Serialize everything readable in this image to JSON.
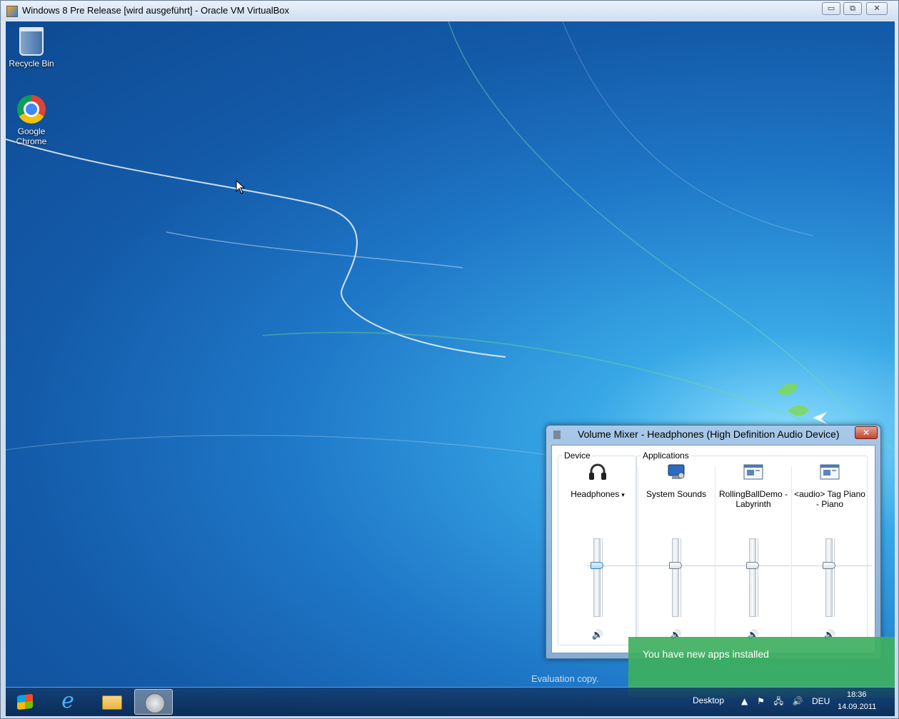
{
  "host": {
    "title": "Windows 8 Pre Release [wird ausgeführt] - Oracle VM VirtualBox",
    "buttons": {
      "minimize": "▭",
      "restore": "⧉",
      "close": "✕"
    }
  },
  "desktop": {
    "icons": [
      {
        "label": "Recycle Bin",
        "icon": "recycle-bin-icon"
      },
      {
        "label": "Google Chrome",
        "icon": "chrome-icon"
      }
    ]
  },
  "mixer": {
    "title": "Volume Mixer - Headphones (High Definition Audio Device)",
    "close": "✕",
    "device_group": "Device",
    "applications_group": "Applications",
    "channels": [
      {
        "label": "Headphones",
        "caret": "▾",
        "icon": "headphones-icon",
        "level": 0.67,
        "mute_glyph": "🔊"
      },
      {
        "label": "System Sounds",
        "icon": "system-sounds-icon",
        "level": 0.67,
        "mute_glyph": "🔊"
      },
      {
        "label": "RollingBallDemo - Labyrinth",
        "icon": "app-window-icon",
        "level": 0.67,
        "mute_glyph": "🔊"
      },
      {
        "label": "<audio> Tag Piano - Piano",
        "icon": "app-window-icon",
        "level": 0.67,
        "mute_glyph": "🔊"
      }
    ]
  },
  "toast": {
    "text": "You have new apps installed"
  },
  "watermark": {
    "text": "Evaluation copy."
  },
  "taskbar": {
    "desktop_label": "Desktop",
    "tray_glyphs": {
      "chevron": "▲",
      "flag": "⚑",
      "network": "🖧",
      "volume": "🔊"
    },
    "language": "DEU",
    "time": "18:36",
    "date": "14.09.2011"
  },
  "colors": {
    "toast_bg": "#3eb060",
    "desktop_blue": "#1f78c8",
    "close_red": "#c4432e"
  }
}
